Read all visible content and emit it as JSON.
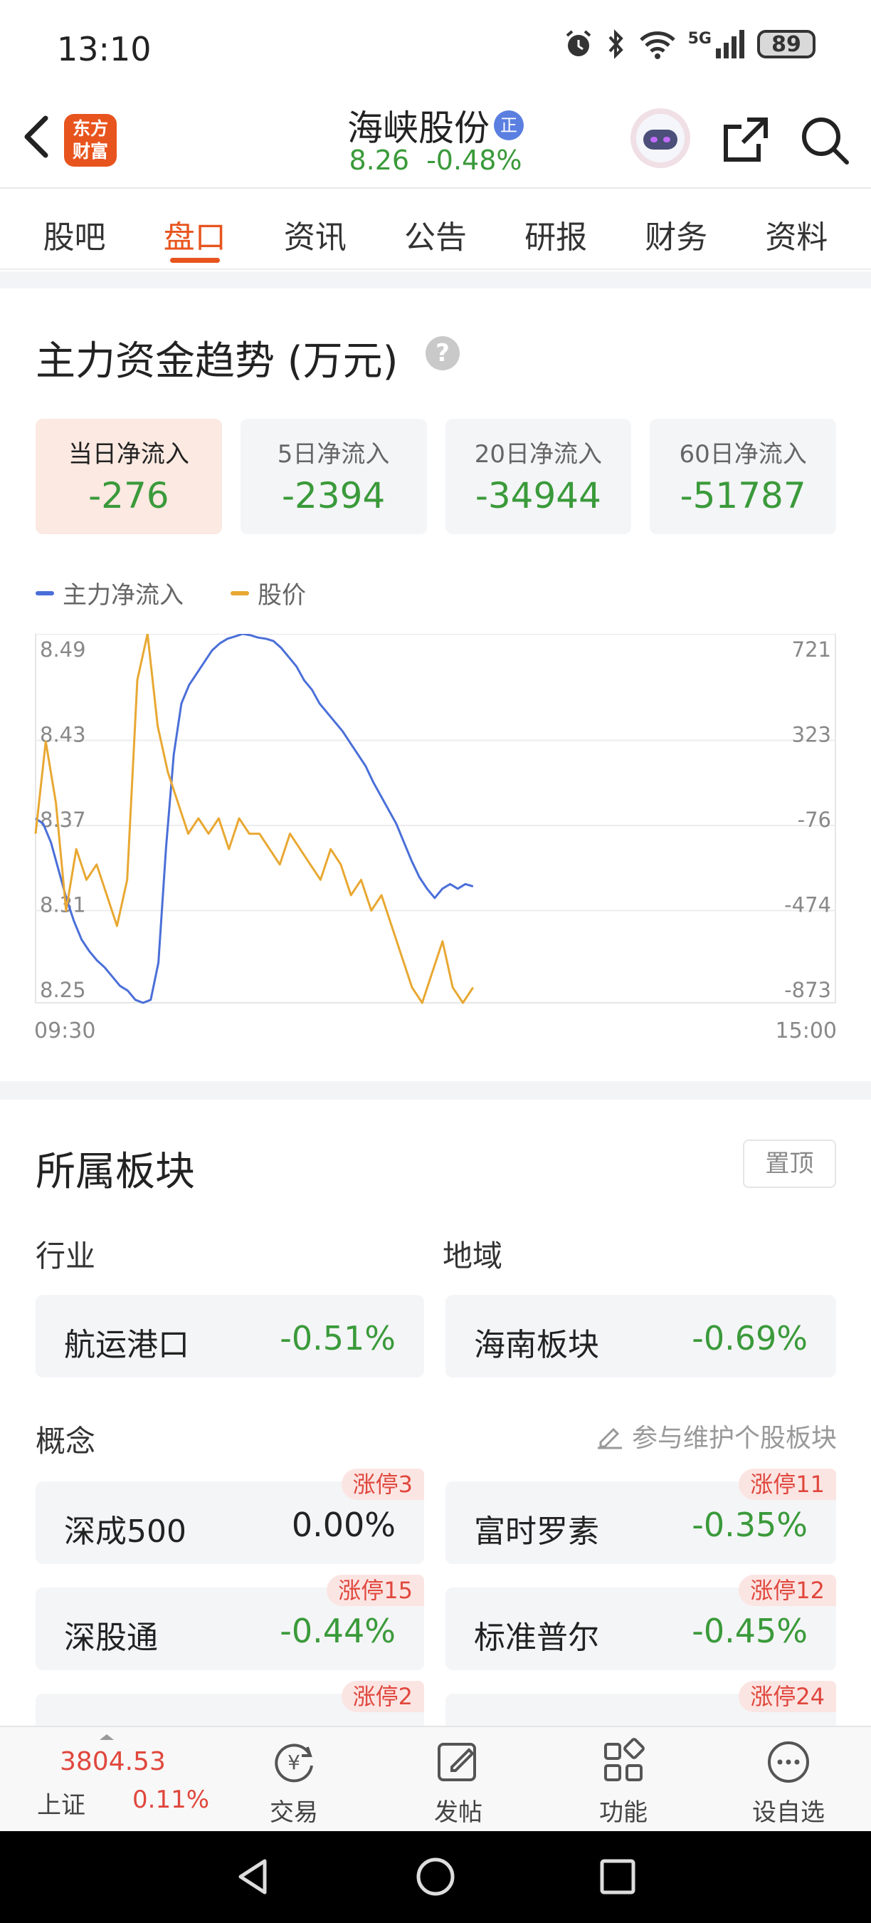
{
  "status": {
    "time": "13:10",
    "network": "5G",
    "battery": "89"
  },
  "header": {
    "logo_line1": "东方",
    "logo_line2": "财富",
    "stock_name": "海峡股份",
    "badge": "正",
    "price": "8.26",
    "change_pct": "-0.48%"
  },
  "tabs": [
    "股吧",
    "盘口",
    "资讯",
    "公告",
    "研报",
    "财务",
    "资料"
  ],
  "active_tab": "盘口",
  "fund_flow": {
    "title": "主力资金趋势 (万元)",
    "help": "?",
    "boxes": [
      {
        "label": "当日净流入",
        "value": "-276"
      },
      {
        "label": "5日净流入",
        "value": "-2394"
      },
      {
        "label": "20日净流入",
        "value": "-34944"
      },
      {
        "label": "60日净流入",
        "value": "-51787"
      }
    ],
    "legend": [
      {
        "label": "主力净流入",
        "color": "#4a6fd8"
      },
      {
        "label": "股价",
        "color": "#e8a832"
      }
    ]
  },
  "chart_data": {
    "type": "line",
    "x_start": "09:30",
    "x_end": "15:00",
    "y_left_ticks": [
      "8.49",
      "8.43",
      "8.37",
      "8.31",
      "8.25"
    ],
    "y_right_ticks": [
      "721",
      "323",
      "-76",
      "-474",
      "-873"
    ],
    "y_left_range": [
      8.25,
      8.49
    ],
    "y_right_range": [
      -873,
      721
    ],
    "series": [
      {
        "name": "主力净流入",
        "color": "#4a6fd8",
        "axis": "right",
        "values": [
          -76,
          -100,
          -180,
          -300,
          -420,
          -520,
          -600,
          -650,
          -690,
          -720,
          -760,
          -800,
          -820,
          -860,
          -873,
          -860,
          -700,
          -200,
          200,
          420,
          500,
          550,
          600,
          650,
          680,
          700,
          710,
          721,
          715,
          705,
          700,
          690,
          660,
          620,
          580,
          520,
          480,
          420,
          380,
          340,
          300,
          250,
          200,
          150,
          80,
          20,
          -40,
          -100,
          -180,
          -260,
          -330,
          -380,
          -420,
          -380,
          -360,
          -380,
          -360,
          -370
        ]
      },
      {
        "name": "股价",
        "color": "#e8a832",
        "axis": "left",
        "values": [
          8.36,
          8.42,
          8.38,
          8.31,
          8.35,
          8.33,
          8.34,
          8.32,
          8.3,
          8.33,
          8.46,
          8.49,
          8.43,
          8.4,
          8.38,
          8.36,
          8.37,
          8.36,
          8.37,
          8.35,
          8.37,
          8.36,
          8.36,
          8.35,
          8.34,
          8.36,
          8.35,
          8.34,
          8.33,
          8.35,
          8.34,
          8.32,
          8.33,
          8.31,
          8.32,
          8.3,
          8.28,
          8.26,
          8.25,
          8.27,
          8.29,
          8.26,
          8.25,
          8.26
        ]
      }
    ]
  },
  "sectors": {
    "title": "所属板块",
    "pin_label": "置顶",
    "industry_label": "行业",
    "region_label": "地域",
    "industry": {
      "name": "航运港口",
      "pct": "-0.51%"
    },
    "region": {
      "name": "海南板块",
      "pct": "-0.69%"
    },
    "concept_label": "概念",
    "maintain_label": "参与维护个股板块",
    "concepts": [
      {
        "name": "深成500",
        "pct": "0.00%",
        "tag": "涨停3"
      },
      {
        "name": "富时罗素",
        "pct": "-0.35%",
        "tag": "涨停11"
      },
      {
        "name": "深股通",
        "pct": "-0.44%",
        "tag": "涨停15"
      },
      {
        "name": "标准普尔",
        "pct": "-0.45%",
        "tag": "涨停12"
      }
    ],
    "partial_tags": [
      "涨停2",
      "涨停24"
    ]
  },
  "bottom": {
    "index_value": "3804.53",
    "index_name": "上证",
    "index_pct": "0.11%",
    "items": [
      {
        "label": "交易",
        "icon": "yuan-cycle-icon"
      },
      {
        "label": "发帖",
        "icon": "edit-post-icon"
      },
      {
        "label": "功能",
        "icon": "grid-icon"
      },
      {
        "label": "设自选",
        "icon": "more-circle-icon"
      }
    ]
  }
}
